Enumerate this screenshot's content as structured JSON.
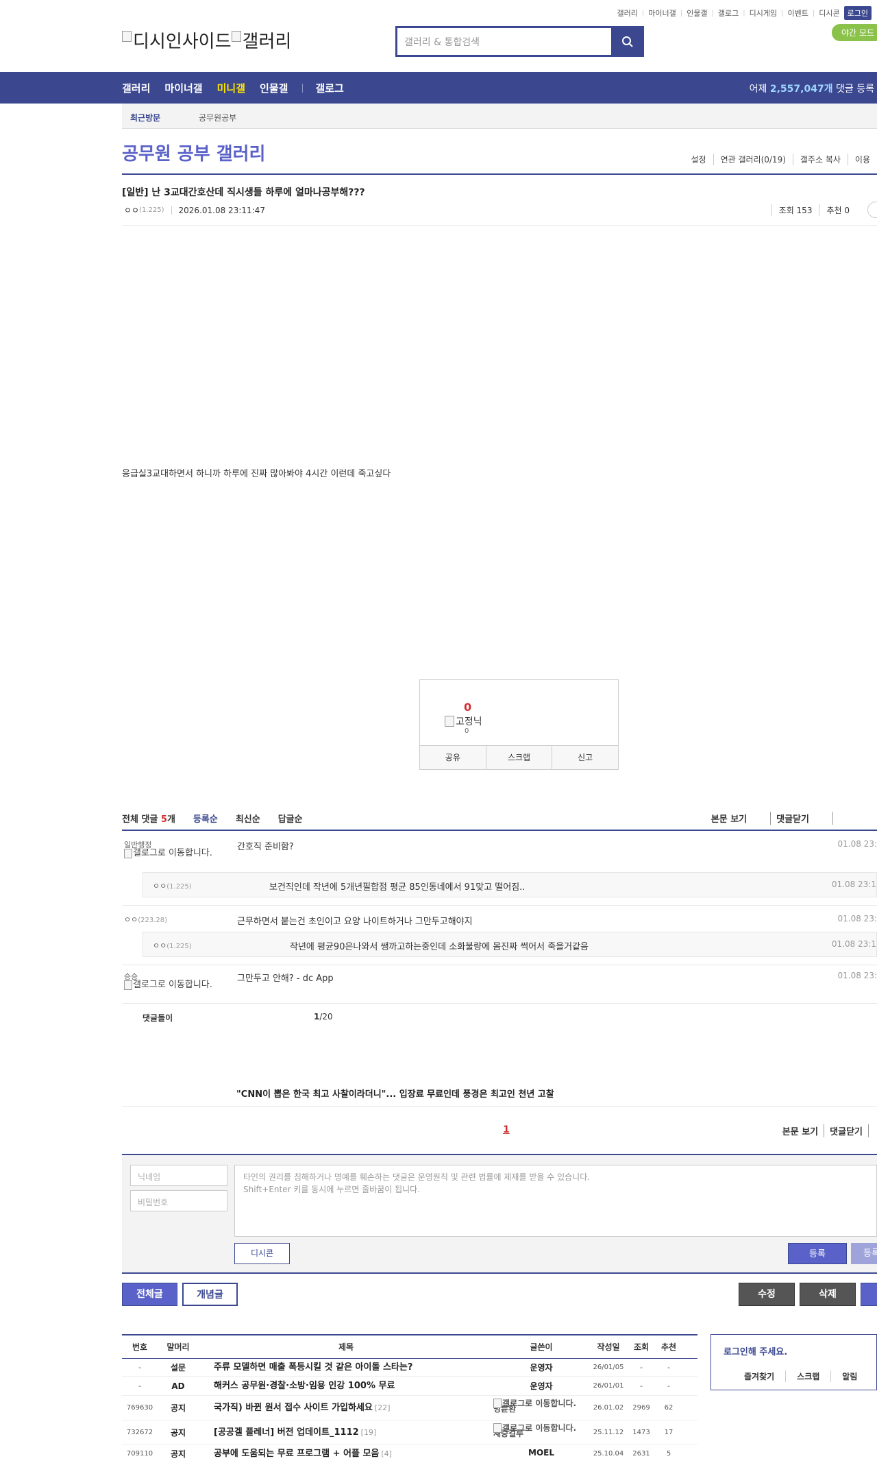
{
  "top": {
    "links": [
      "갤러리",
      "마이너갤",
      "인물갤",
      "갤로그",
      "디시게임",
      "이벤트",
      "디시콘"
    ],
    "login": "로그인",
    "night_mode": "야간 모드",
    "logo_text_1": "디시인사이드",
    "logo_text_2": "갤러리",
    "search_placeholder": "갤러리 & 통합검색"
  },
  "gnb": {
    "items": [
      "갤러리",
      "마이너갤",
      "미니갤",
      "인물갤",
      "갤로그"
    ],
    "active": "미니갤",
    "stat_prefix": "어제 ",
    "stat_value": "2,557,047개",
    "stat_suffix": " 댓글 등록"
  },
  "recent": {
    "label": "최근방문",
    "item": "공무원공부"
  },
  "gallery": {
    "title": "공무원 공부 갤러리",
    "tools": [
      "설정",
      "연관 갤러리(0/19)",
      "갤주소 복사",
      "이용"
    ]
  },
  "post": {
    "title": "[일반] 난 3교대간호산데 직시생들 하루에 얼마나공부해???",
    "author": "ㅇㅇ",
    "author_ip": "(1.225)",
    "date": "2026.01.08 23:11:47",
    "views": "조회 153",
    "recommend": "추천 0",
    "body": "응급실3교대하면서 하니까 하루에 진짜 많아봐야 4시간 이런데 죽고싶다"
  },
  "reco_box": {
    "count": "0",
    "fixed_label": "고정닉",
    "fixed_count": "0",
    "actions": [
      "공유",
      "스크랩",
      "신고"
    ]
  },
  "comments": {
    "total_label": "전체 댓글",
    "total_count": "5",
    "total_unit": "개",
    "sorts": [
      "등록순",
      "최신순",
      "답글순"
    ],
    "right_links": [
      "본문 보기",
      "댓글닫기"
    ],
    "glog_move": "갤로그로 이동합니다.",
    "items": [
      {
        "nick": "일반행정",
        "ip": "",
        "text": "간호직 준비함?",
        "date": "01.08 23:"
      },
      {
        "nick": "ㅇㅇ",
        "ip": "(1.225)",
        "text": "보건직인데 작년에 5개년필합점 평균 85인동네에서 91맞고 떨어짐..",
        "date": "01.08 23:1"
      },
      {
        "nick": "ㅇㅇ",
        "ip": "(223.28)",
        "text": "근무하면서 붙는건 초인이고 요양 나이트하거나 그만두고해야지",
        "date": "01.08 23:"
      },
      {
        "nick": "ㅇㅇ",
        "ip": "(1.225)",
        "text": "작년에 평균90은나와서 쌩까고하는중인데 소화불량에 몸진짜 썩어서 죽을거같음",
        "date": "01.08 23:1"
      },
      {
        "nick": "승승",
        "ip": "",
        "text": "그만두고 안해? - dc App",
        "date": "01.08 23:"
      }
    ],
    "bot_label": "댓글돌이",
    "page_current": "1",
    "page_total": "/20",
    "ad_link": "\"CNN이 뽑은 한국 최고 사찰이라더니\"... 입장료 무료인데 풍경은 최고인 천년 고찰",
    "pager_current": "1"
  },
  "write": {
    "nick_placeholder": "닉네임",
    "pw_placeholder": "비밀번호",
    "textarea_line1": "타인의 권리를 침해하거나 명예를 훼손하는 댓글은 운영원칙 및 관련 법률에 제재를 받을 수 있습니다.",
    "textarea_line2": "Shift+Enter 키를 동시에 누르면 줄바꿈이 됩니다.",
    "dccon": "디시콘",
    "submit": "등록",
    "submit2": "등록"
  },
  "list_buttons": {
    "all": "전체글",
    "concept": "개념글",
    "edit": "수정",
    "delete": "삭제"
  },
  "board": {
    "headers": [
      "번호",
      "말머리",
      "제목",
      "글쓴이",
      "작성일",
      "조회",
      "추천"
    ],
    "rows": [
      {
        "num": "-",
        "head": "설문",
        "subject": "주류 모델하면 매출 폭등시킬 것 같은 아이돌 스타는?",
        "reply": "",
        "writer": "운영자",
        "glog": false,
        "date": "26/01/05",
        "views": "-",
        "reco": "-"
      },
      {
        "num": "-",
        "head": "AD",
        "subject": "해커스 공무원·경찰·소방·임용 인강 100% 무료",
        "reply": "",
        "writer": "운영자",
        "glog": false,
        "date": "26/01/01",
        "views": "-",
        "reco": "-"
      },
      {
        "num": "769630",
        "head": "공지",
        "subject": "국가직) 바뀐 원서 접수 사이트 가입하세요",
        "reply": "[22]",
        "writer": "빙륜환",
        "glog": true,
        "date": "26.01.02",
        "views": "2969",
        "reco": "62"
      },
      {
        "num": "732672",
        "head": "공지",
        "subject": "[공공겔 플레너] 버전 업데이트_1112",
        "reply": "[19]",
        "writer": "재증걸루",
        "glog": true,
        "date": "25.11.12",
        "views": "1473",
        "reco": "17"
      },
      {
        "num": "709110",
        "head": "공지",
        "subject": "공부에 도움되는 무료 프로그램 + 어플 모음",
        "reply": "[4]",
        "writer": "MOEL",
        "glog": false,
        "date": "25.10.04",
        "views": "2631",
        "reco": "5"
      }
    ]
  },
  "login_panel": {
    "title": "로그인해 주세요.",
    "links": [
      "즐겨찾기",
      "스크랩",
      "알림"
    ]
  },
  "colors": {
    "brand": "#3b4890",
    "accent": "#5a62c9",
    "highlight": "#ffe400",
    "red": "#d32f2f"
  }
}
